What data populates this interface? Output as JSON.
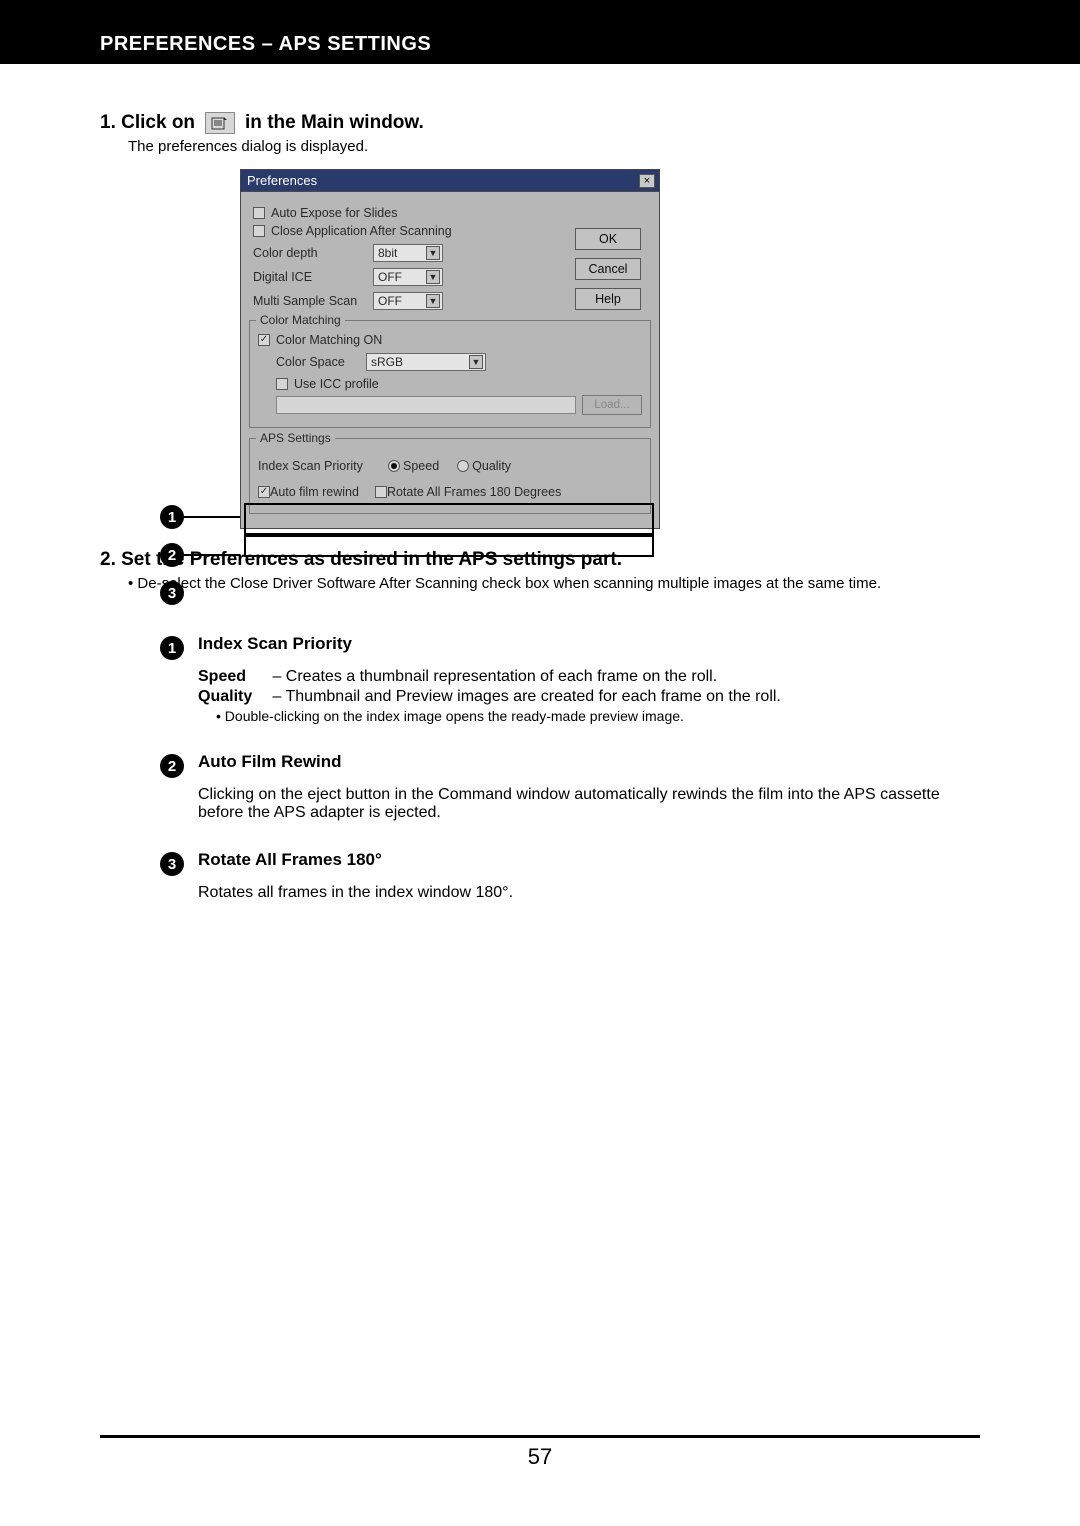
{
  "header": {
    "title": "PREFERENCES – APS SETTINGS"
  },
  "step1": {
    "prefix": "1.  Click on",
    "suffix": "in the Main window.",
    "subtext": "The preferences dialog is displayed."
  },
  "dialog": {
    "title": "Preferences",
    "close": "×",
    "buttons": {
      "ok": "OK",
      "cancel": "Cancel",
      "help": "Help",
      "load": "Load..."
    },
    "checks": {
      "autoExpose": "Auto Expose for Slides",
      "closeApp": "Close Application After Scanning",
      "colorMatchOn": "Color Matching ON",
      "useIcc": "Use ICC profile",
      "autoFilmRewind": "Auto film rewind",
      "rotateAll": "Rotate All Frames 180 Degrees"
    },
    "checked": {
      "autoExpose": false,
      "closeApp": false,
      "colorMatchOn": true,
      "useIcc": false,
      "autoFilmRewind": true,
      "rotateAll": false
    },
    "settings": {
      "colorDepth": {
        "label": "Color depth",
        "value": "8bit"
      },
      "digitalIce": {
        "label": "Digital ICE",
        "value": "OFF"
      },
      "multiSample": {
        "label": "Multi Sample Scan",
        "value": "OFF"
      },
      "colorSpace": {
        "label": "Color Space",
        "value": "sRGB"
      }
    },
    "groups": {
      "colorMatching": "Color Matching",
      "apsSettings": "APS Settings"
    },
    "aps": {
      "indexScanPriority": "Index Scan Priority",
      "speed": "Speed",
      "quality": "Quality",
      "selected": "speed"
    }
  },
  "callouts": {
    "c1": "1",
    "c2": "2",
    "c3": "3"
  },
  "step2": {
    "title": "2.  Set the Preferences as desired in the APS settings part.",
    "bullet": "• De-select the Close Driver Software After Scanning check box when scanning multiple images at the same time."
  },
  "defs": {
    "d1": {
      "badge": "1",
      "title": "Index Scan Priority",
      "speedTerm": "Speed",
      "speedDesc": "– Creates a thumbnail representation of each frame on the roll.",
      "qualityTerm": "Quality",
      "qualityDesc": "– Thumbnail and Preview images are created for each frame on the roll.",
      "note": "• Double-clicking on the index image opens the ready-made preview image."
    },
    "d2": {
      "badge": "2",
      "title": "Auto Film Rewind",
      "para": "Clicking on the eject button in the Command window automatically rewinds the film into the APS cassette before the APS adapter is ejected."
    },
    "d3": {
      "badge": "3",
      "title": "Rotate All Frames 180°",
      "para": "Rotates all frames in the index window 180°."
    }
  },
  "footer": {
    "pageNumber": "57"
  }
}
